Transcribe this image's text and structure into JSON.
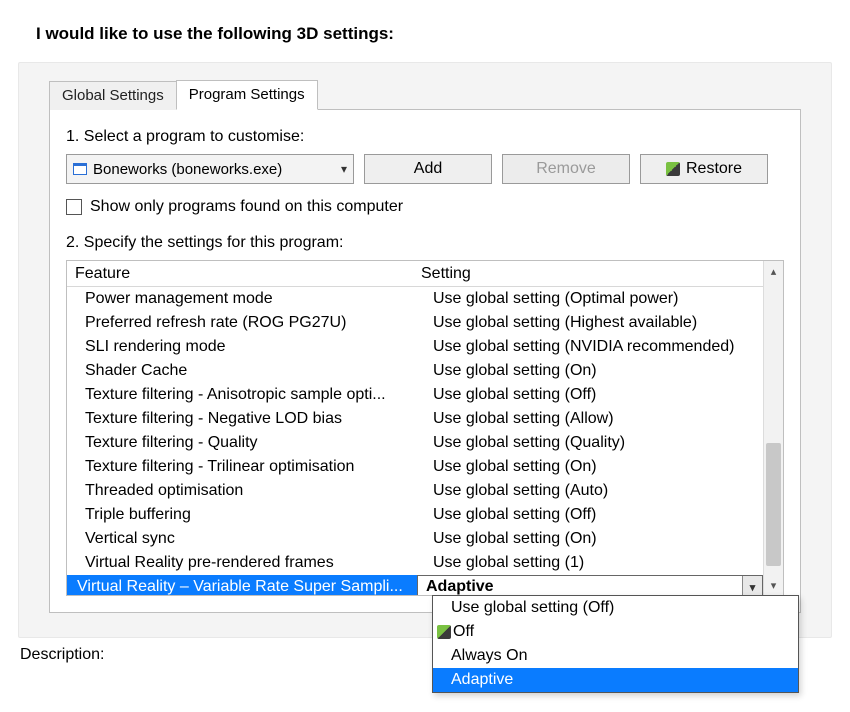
{
  "heading": "I would like to use the following 3D settings:",
  "tabs": {
    "global": "Global Settings",
    "program": "Program Settings"
  },
  "step1_label": "1. Select a program to customise:",
  "program_combo": "Boneworks (boneworks.exe)",
  "buttons": {
    "add": "Add",
    "remove": "Remove",
    "restore": "Restore"
  },
  "show_only_label": "Show only programs found on this computer",
  "step2_label": "2. Specify the settings for this program:",
  "columns": {
    "feature": "Feature",
    "setting": "Setting"
  },
  "rows": [
    {
      "feature": "Power management mode",
      "setting": "Use global setting (Optimal power)"
    },
    {
      "feature": "Preferred refresh rate (ROG PG27U)",
      "setting": "Use global setting (Highest available)"
    },
    {
      "feature": "SLI rendering mode",
      "setting": "Use global setting (NVIDIA recommended)"
    },
    {
      "feature": "Shader Cache",
      "setting": "Use global setting (On)"
    },
    {
      "feature": "Texture filtering - Anisotropic sample opti...",
      "setting": "Use global setting (Off)"
    },
    {
      "feature": "Texture filtering - Negative LOD bias",
      "setting": "Use global setting (Allow)"
    },
    {
      "feature": "Texture filtering - Quality",
      "setting": "Use global setting (Quality)"
    },
    {
      "feature": "Texture filtering - Trilinear optimisation",
      "setting": "Use global setting (On)"
    },
    {
      "feature": "Threaded optimisation",
      "setting": "Use global setting (Auto)"
    },
    {
      "feature": "Triple buffering",
      "setting": "Use global setting (Off)"
    },
    {
      "feature": "Vertical sync",
      "setting": "Use global setting (On)"
    },
    {
      "feature": "Virtual Reality pre-rendered frames",
      "setting": "Use global setting (1)"
    }
  ],
  "selected_row": {
    "feature": "Virtual Reality – Variable Rate Super Sampli...",
    "setting": "Adaptive"
  },
  "dropdown": {
    "opt0": "Use global setting (Off)",
    "opt1": "Off",
    "opt2": "Always On",
    "opt3": "Adaptive"
  },
  "description_label": "Description:"
}
